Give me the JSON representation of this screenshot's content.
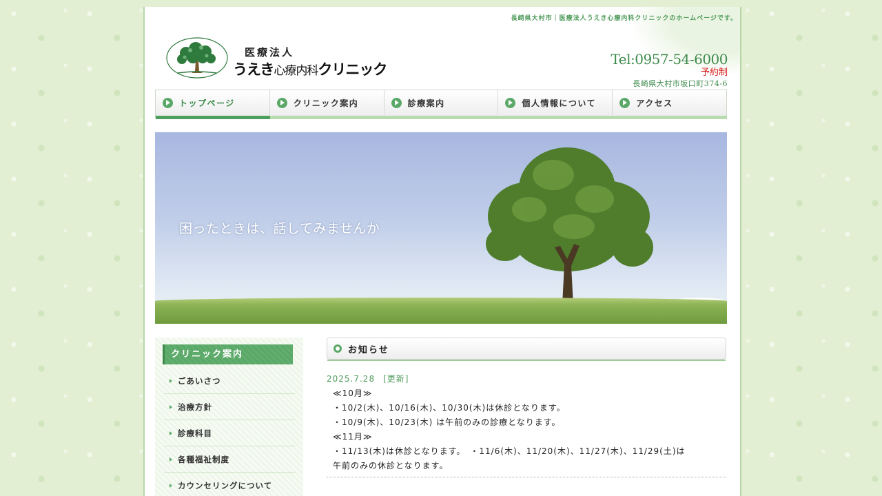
{
  "header": {
    "tagline": "長崎県大村市｜医療法人うえき心療内科クリニックのホームページです。",
    "logo": {
      "subtitle": "医療法人",
      "name_left": "うえき",
      "name_mid": "心療内科",
      "name_right": "クリニック"
    },
    "contact": {
      "tel": "Tel:0957-54-6000",
      "reservation": "予約制",
      "address": "長崎県大村市坂口町374-6"
    }
  },
  "nav": {
    "items": [
      {
        "label": "トップページ",
        "active": true
      },
      {
        "label": "クリニック案内",
        "active": false
      },
      {
        "label": "診療案内",
        "active": false
      },
      {
        "label": "個人情報について",
        "active": false
      },
      {
        "label": "アクセス",
        "active": false
      }
    ]
  },
  "hero": {
    "copy": "困ったときは、話してみませんか"
  },
  "sidebar": {
    "heading": "クリニック案内",
    "items": [
      {
        "label": "ごあいさつ"
      },
      {
        "label": "治療方針"
      },
      {
        "label": "診療科目"
      },
      {
        "label": "各種福祉制度"
      },
      {
        "label": "カウンセリングについて"
      }
    ]
  },
  "news": {
    "heading": "お知らせ",
    "date": "2025.7.28",
    "badge": "[更新]",
    "lines": [
      "≪10月≫",
      "・10/2(木)、10/16(木)、10/30(木)は休診となります。",
      "・10/9(木)、10/23(木) は午前のみの診療となります。",
      "≪11月≫",
      "・11/13(木)は休診となります。　・11/6(木)、11/20(木)、11/27(木)、11/29(土)は",
      "午前のみの休診となります。"
    ]
  },
  "colors": {
    "accent_green": "#5aa867",
    "text_green": "#3d8a4b",
    "reservation_red": "#d81f1f",
    "background": "#e3efd3"
  }
}
